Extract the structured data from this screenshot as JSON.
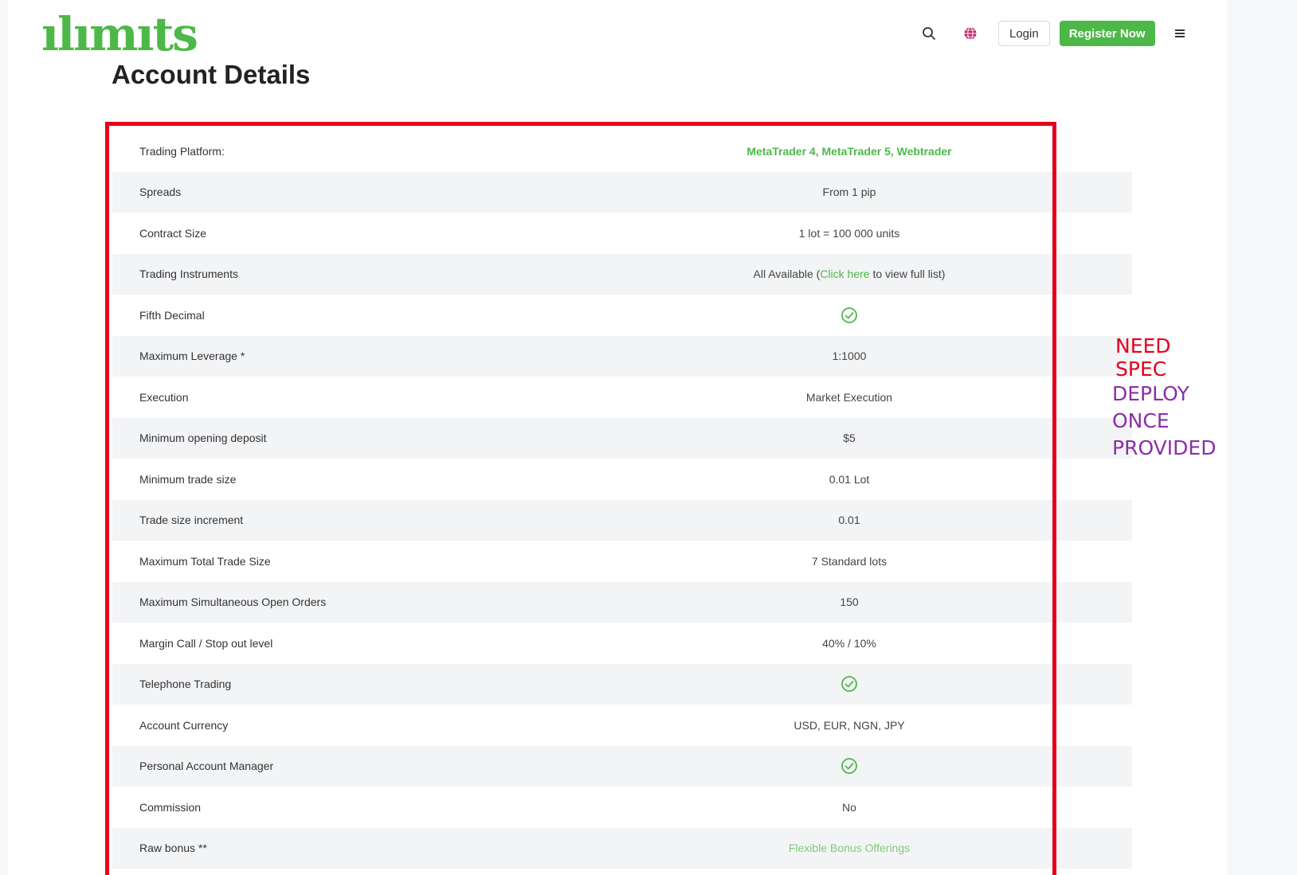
{
  "header": {
    "logo_text": "ılımıts",
    "search_icon": "search-icon",
    "language_icon": "globe-icon",
    "login_label": "Login",
    "register_label": "Register Now",
    "menu_icon": "hamburger-menu-icon",
    "brand_color": "#4db848"
  },
  "page_title": "Account Details",
  "details": [
    {
      "label": "Trading Platform:",
      "value": "MetaTrader 4, MetaTrader 5, Webtrader",
      "style": "green"
    },
    {
      "label": "Spreads",
      "value": "From 1 pip"
    },
    {
      "label": "Contract Size",
      "value": "1 lot = 100 000 units"
    },
    {
      "label": "Trading Instruments",
      "value_prefix": "All Available (",
      "value_link": "Click here",
      "value_suffix": " to view full list)"
    },
    {
      "label": "Fifth Decimal",
      "value": "check-circle-icon",
      "is_icon": true
    },
    {
      "label": "Maximum Leverage *",
      "value": "1:1000"
    },
    {
      "label": "Execution",
      "value": "Market Execution"
    },
    {
      "label": "Minimum opening deposit",
      "value": "$5"
    },
    {
      "label": "Minimum trade size",
      "value": "0.01 Lot"
    },
    {
      "label": "Trade size increment",
      "value": "0.01"
    },
    {
      "label": "Maximum Total Trade Size",
      "value": "7 Standard lots"
    },
    {
      "label": "Maximum Simultaneous Open Orders",
      "value": "150"
    },
    {
      "label": "Margin Call / Stop out level",
      "value": "40% / 10%"
    },
    {
      "label": "Telephone Trading",
      "value": "check-circle-icon",
      "is_icon": true
    },
    {
      "label": "Account Currency",
      "value": "USD, EUR, NGN, JPY"
    },
    {
      "label": "Personal Account Manager",
      "value": "check-circle-icon",
      "is_icon": true
    },
    {
      "label": "Commission",
      "value": "No"
    },
    {
      "label": "Raw bonus **",
      "value": "Flexible Bonus Offerings",
      "style": "green-light"
    }
  ],
  "annotations": {
    "need_spec": "NEED SPEC",
    "deploy_line1": "DEPLOY ONCE",
    "deploy_line2": "PROVIDED",
    "highlight_color": "#e3001b",
    "note_color": "#8b2fa6"
  }
}
